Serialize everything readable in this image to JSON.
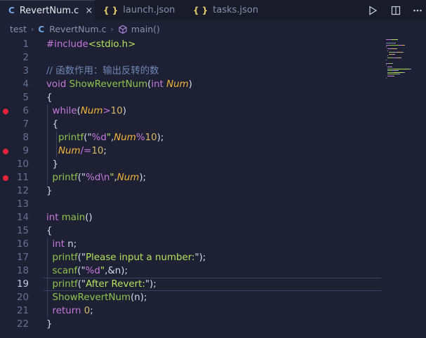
{
  "tabs": [
    {
      "icon": "C",
      "label": "RevertNum.c",
      "active": true,
      "close": "×"
    },
    {
      "icon": "{ }",
      "label": "launch.json",
      "active": false
    },
    {
      "icon": "{ }",
      "label": "tasks.json",
      "active": false
    }
  ],
  "breadcrumb": {
    "folder": "test",
    "file_icon": "C",
    "file": "RevertNum.c",
    "symbol": "main()"
  },
  "editor": {
    "current_line": 19,
    "breakpoints": [
      6,
      9,
      11
    ],
    "lines": [
      {
        "n": "1",
        "code": [
          [
            "pp",
            "#include"
          ],
          [
            "inc",
            "<stdio.h>"
          ]
        ]
      },
      {
        "n": "2",
        "code": []
      },
      {
        "n": "3",
        "code": [
          [
            "c",
            "// 函数作用：输出反转的数"
          ]
        ]
      },
      {
        "n": "4",
        "code": [
          [
            "k",
            "void "
          ],
          [
            "f",
            "ShowRevertNum"
          ],
          [
            "d",
            "("
          ],
          [
            "k",
            "int "
          ],
          [
            "p",
            "Num"
          ],
          [
            "d",
            ")"
          ]
        ]
      },
      {
        "n": "5",
        "code": [
          [
            "d",
            "{"
          ]
        ]
      },
      {
        "n": "6",
        "code": [
          [
            "d",
            "  "
          ],
          [
            "k",
            "while"
          ],
          [
            "d",
            "("
          ],
          [
            "p",
            "Num"
          ],
          [
            "o",
            ">"
          ],
          [
            "n",
            "10"
          ],
          [
            "d",
            ")"
          ]
        ]
      },
      {
        "n": "7",
        "code": [
          [
            "d",
            "  {"
          ]
        ]
      },
      {
        "n": "8",
        "code": [
          [
            "d",
            "    "
          ],
          [
            "f",
            "printf"
          ],
          [
            "d",
            "(\""
          ],
          [
            "e",
            "%d"
          ],
          [
            "s",
            "\""
          ],
          [
            "d",
            ","
          ],
          [
            "p",
            "Num"
          ],
          [
            "o",
            "%"
          ],
          [
            "n",
            "10"
          ],
          [
            "d",
            ");"
          ]
        ]
      },
      {
        "n": "9",
        "code": [
          [
            "d",
            "    "
          ],
          [
            "p",
            "Num"
          ],
          [
            "o",
            "/="
          ],
          [
            "n",
            "10"
          ],
          [
            "d",
            ";"
          ]
        ]
      },
      {
        "n": "10",
        "code": [
          [
            "d",
            "  }"
          ]
        ]
      },
      {
        "n": "11",
        "code": [
          [
            "d",
            "  "
          ],
          [
            "f",
            "printf"
          ],
          [
            "d",
            "(\""
          ],
          [
            "e",
            "%d\\n"
          ],
          [
            "s",
            "\""
          ],
          [
            "d",
            ","
          ],
          [
            "p",
            "Num"
          ],
          [
            "d",
            ");"
          ]
        ]
      },
      {
        "n": "12",
        "code": [
          [
            "d",
            "}"
          ]
        ]
      },
      {
        "n": "13",
        "code": []
      },
      {
        "n": "14",
        "code": [
          [
            "k",
            "int "
          ],
          [
            "f",
            "main"
          ],
          [
            "d",
            "()"
          ]
        ]
      },
      {
        "n": "15",
        "code": [
          [
            "d",
            "{"
          ]
        ]
      },
      {
        "n": "16",
        "code": [
          [
            "d",
            "  "
          ],
          [
            "k",
            "int "
          ],
          [
            "d",
            "n;"
          ]
        ]
      },
      {
        "n": "17",
        "code": [
          [
            "d",
            "  "
          ],
          [
            "f",
            "printf"
          ],
          [
            "d",
            "(\""
          ],
          [
            "s",
            "Please input a number:"
          ],
          [
            "d",
            "\");"
          ]
        ]
      },
      {
        "n": "18",
        "code": [
          [
            "d",
            "  "
          ],
          [
            "f",
            "scanf"
          ],
          [
            "d",
            "(\""
          ],
          [
            "e",
            "%d"
          ],
          [
            "s",
            "\""
          ],
          [
            "d",
            ",&n);"
          ]
        ]
      },
      {
        "n": "19",
        "code": [
          [
            "d",
            "  "
          ],
          [
            "f",
            "printf"
          ],
          [
            "d",
            "(\""
          ],
          [
            "s",
            "After Revert:"
          ],
          [
            "d",
            "\");"
          ]
        ]
      },
      {
        "n": "20",
        "code": [
          [
            "d",
            "  "
          ],
          [
            "f",
            "ShowRevertNum"
          ],
          [
            "d",
            "(n);"
          ]
        ]
      },
      {
        "n": "21",
        "code": [
          [
            "d",
            "  "
          ],
          [
            "k",
            "return "
          ],
          [
            "n",
            "0"
          ],
          [
            "d",
            ";"
          ]
        ]
      },
      {
        "n": "22",
        "code": [
          [
            "d",
            "}"
          ]
        ]
      }
    ]
  },
  "colors": {
    "bg": "#1e2134",
    "keyword": "#c678dd",
    "function": "#8ec44c",
    "param": "#f3b53a",
    "string": "#b6e25c",
    "comment": "#6f86b5",
    "breakpoint": "#e5243c"
  }
}
